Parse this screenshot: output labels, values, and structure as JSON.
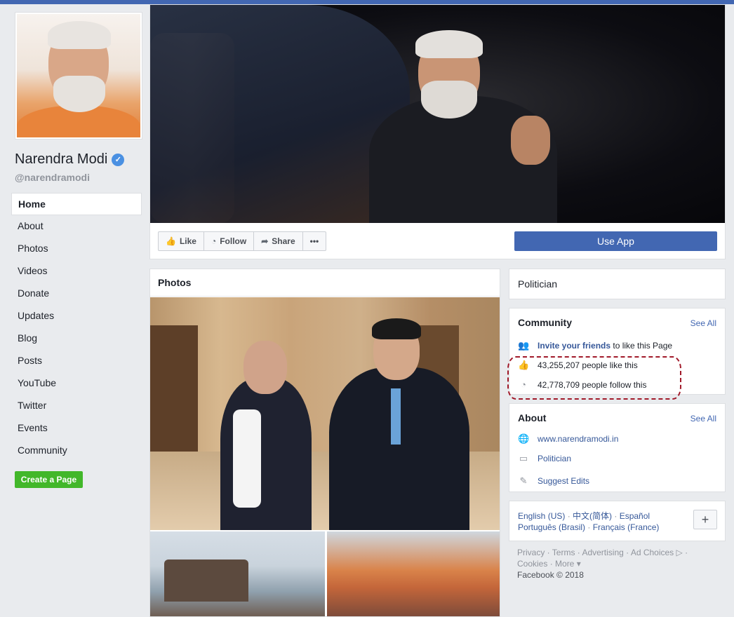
{
  "page": {
    "name": "Narendra Modi",
    "verified_icon": "✓",
    "handle": "@narendramodi"
  },
  "nav": {
    "items": [
      {
        "label": "Home",
        "active": true
      },
      {
        "label": "About"
      },
      {
        "label": "Photos"
      },
      {
        "label": "Videos"
      },
      {
        "label": "Donate"
      },
      {
        "label": "Updates"
      },
      {
        "label": "Blog"
      },
      {
        "label": "Posts"
      },
      {
        "label": "YouTube"
      },
      {
        "label": "Twitter"
      },
      {
        "label": "Events"
      },
      {
        "label": "Community"
      }
    ],
    "create_page": "Create a Page"
  },
  "actions": {
    "like": "Like",
    "follow": "Follow",
    "share": "Share",
    "more": "•••",
    "use_app": "Use App"
  },
  "photos": {
    "title": "Photos"
  },
  "category": "Politician",
  "community": {
    "title": "Community",
    "see_all": "See All",
    "invite_link": "Invite your friends",
    "invite_rest": " to like this Page",
    "likes": "43,255,207 people like this",
    "follows": "42,778,709 people follow this"
  },
  "about": {
    "title": "About",
    "see_all": "See All",
    "website": "www.narendramodi.in",
    "category": "Politician",
    "suggest": "Suggest Edits"
  },
  "languages": {
    "line1": [
      "English (US)",
      "中文(简体)",
      "Español"
    ],
    "line2": [
      "Português (Brasil)",
      "Français (France)"
    ],
    "plus": "+"
  },
  "footer": {
    "line1": "Privacy · Terms · Advertising · Ad Choices ▷ ·",
    "line2": "Cookies · More ▾",
    "copyright": "Facebook © 2018"
  },
  "colors": {
    "brand": "#4267b2",
    "create_button": "#42b72a",
    "link": "#365899",
    "highlight_annotation": "#a11a2a"
  }
}
